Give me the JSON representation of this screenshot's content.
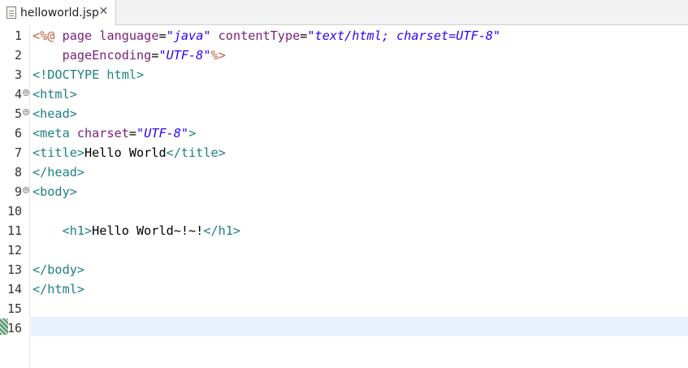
{
  "tab": {
    "title": "helloworld.jsp",
    "close": "✕"
  },
  "gutter": {
    "line_numbers": [
      "1",
      "2",
      "3",
      "4",
      "5",
      "6",
      "7",
      "8",
      "9",
      "10",
      "11",
      "12",
      "13",
      "14",
      "15",
      "16"
    ],
    "fold_marks": [
      "⊖",
      "⊖",
      "⊖"
    ]
  },
  "code": {
    "l1": {
      "open": "<%@",
      "kw": " page ",
      "a1": "language",
      "eq1": "=",
      "v1": "\"java\"",
      "sp": " ",
      "a2": "contentType",
      "eq2": "=",
      "v2": "\"text/html; charset=UTF-8\""
    },
    "l2": {
      "indent": "    ",
      "a": "pageEncoding",
      "eq": "=",
      "v": "\"UTF-8\"",
      "close": "%>"
    },
    "l3": {
      "text": "<!DOCTYPE html>"
    },
    "l4": {
      "text": "<html>"
    },
    "l5": {
      "text": "<head>"
    },
    "l6": {
      "open": "<meta ",
      "a": "charset",
      "eq": "=",
      "v": "\"UTF-8\"",
      "close": ">"
    },
    "l7": {
      "open": "<title>",
      "content": "Hello World",
      "close": "</title>"
    },
    "l8": {
      "text": "</head>"
    },
    "l9": {
      "text": "<body>"
    },
    "l10": {
      "text": ""
    },
    "l11": {
      "indent": "    ",
      "open": "<h1>",
      "content": "Hello World~!~!",
      "close": "</h1>"
    },
    "l12": {
      "text": ""
    },
    "l13": {
      "text": "</body>"
    },
    "l14": {
      "text": "</html>"
    },
    "l15": {
      "text": ""
    },
    "l16": {
      "text": ""
    }
  }
}
